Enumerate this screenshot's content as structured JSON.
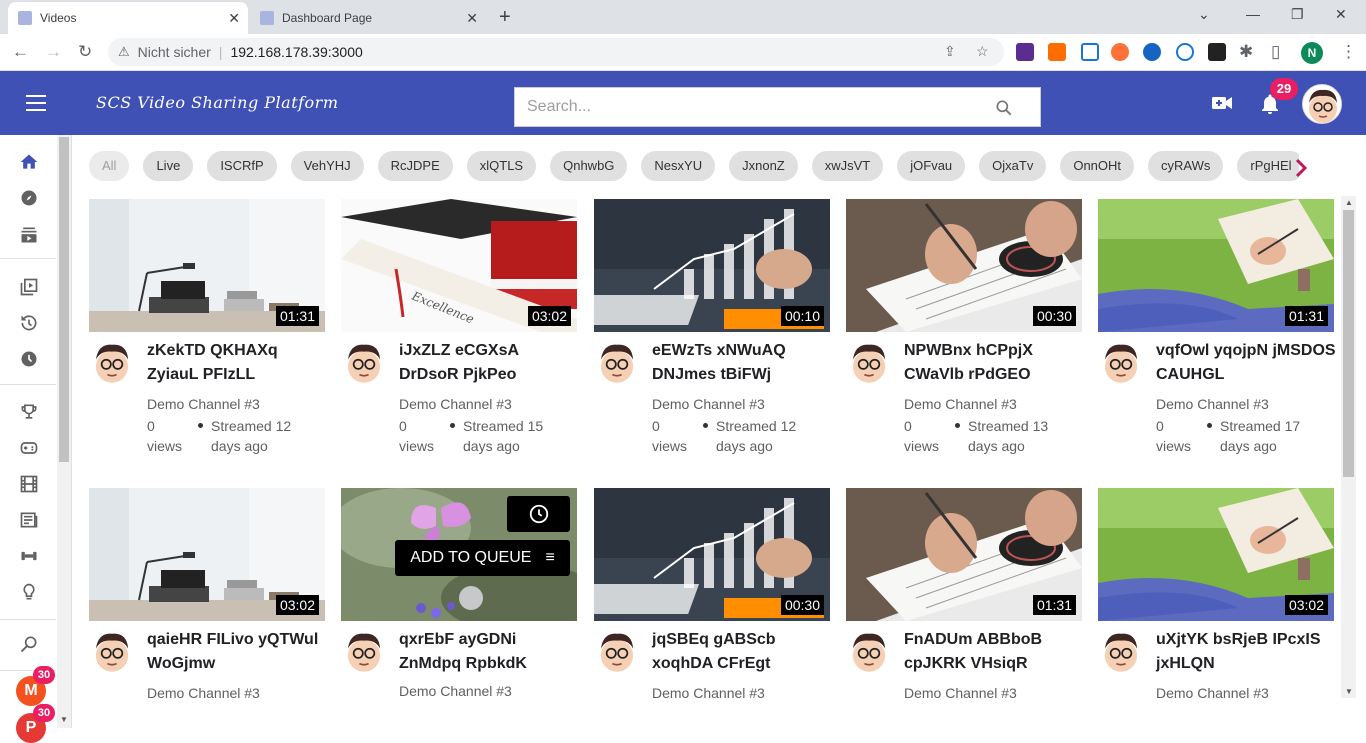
{
  "browser": {
    "tabs": [
      {
        "title": "Videos",
        "active": true
      },
      {
        "title": "Dashboard Page",
        "active": false
      }
    ],
    "security_label": "Nicht sicher",
    "url": "192.168.178.39:3000",
    "profile_initial": "N",
    "extensions": [
      "shield-10-extension",
      "off-extension",
      "camera-extension",
      "firefox-extension",
      "amazon-extension",
      "reader-extension",
      "angular-extension",
      "puzzle-extension",
      "sidebar-extension"
    ],
    "extension_badges": {
      "shield": "10",
      "off": "off"
    }
  },
  "header": {
    "logo_text": "SCS Video Sharing Platform",
    "search_placeholder": "Search...",
    "notification_count": "29",
    "brand_color": "#3f51b5"
  },
  "sidebar": {
    "items": [
      "home-icon",
      "explore-icon",
      "subscriptions-icon",
      "library-icon",
      "history-icon",
      "watch-later-icon",
      "trophy-icon",
      "gaming-icon",
      "movies-icon",
      "news-icon",
      "sports-icon",
      "learning-icon",
      "search-icon"
    ],
    "users": [
      {
        "initial": "M",
        "badge": "30",
        "color": "#f4511e"
      },
      {
        "initial": "P",
        "badge": "30",
        "color": "#e53935"
      }
    ]
  },
  "chips": [
    "All",
    "Live",
    "ISCRfP",
    "VehYHJ",
    "RcJDPE",
    "xlQTLS",
    "QnhwbG",
    "NesxYU",
    "JxnonZ",
    "xwJsVT",
    "jOFvau",
    "OjxaTv",
    "OnnOHt",
    "cyRAWs",
    "rPgHEl"
  ],
  "videos": [
    {
      "title": "zKekTD QKHAXq ZyiauL PFIzLL",
      "channel": "Demo Channel #3",
      "views": "0 views",
      "streamed": "Streamed 12 days ago",
      "duration": "01:31",
      "thumb": "desk"
    },
    {
      "title": "iJxZLZ eCGXsA DrDsoR PjkPeo",
      "channel": "Demo Channel #3",
      "views": "0 views",
      "streamed": "Streamed 15 days ago",
      "duration": "03:02",
      "thumb": "grad"
    },
    {
      "title": "eEWzTs xNWuAQ DNJmes tBiFWj",
      "channel": "Demo Channel #3",
      "views": "0 views",
      "streamed": "Streamed 12 days ago",
      "duration": "00:10",
      "thumb": "chart"
    },
    {
      "title": "NPWBnx hCPpjX CWaVlb rPdGEO",
      "channel": "Demo Channel #3",
      "views": "0 views",
      "streamed": "Streamed 13 days ago",
      "duration": "00:30",
      "thumb": "writing"
    },
    {
      "title": "vqfOwl yqojpN jMSDOS CAUHGL",
      "channel": "Demo Channel #3",
      "views": "0 views",
      "streamed": "Streamed 17 days ago",
      "duration": "01:31",
      "thumb": "grass"
    },
    {
      "title": "qaieHR FILivo yQTWul WoGjmw",
      "channel": "Demo Channel #3",
      "views": "",
      "streamed": "",
      "duration": "03:02",
      "thumb": "desk"
    },
    {
      "title": "qxrEbF ayGDNi ZnMdpq RpbkdK",
      "channel": "Demo Channel #3",
      "views": "",
      "streamed": "",
      "duration": "",
      "thumb": "butterfly",
      "add_to_queue": "ADD TO QUEUE"
    },
    {
      "title": "jqSBEq gABScb xoqhDA CFrEgt",
      "channel": "Demo Channel #3",
      "views": "",
      "streamed": "",
      "duration": "00:30",
      "thumb": "chart"
    },
    {
      "title": "FnADUm ABBboB cpJKRK VHsiqR",
      "channel": "Demo Channel #3",
      "views": "",
      "streamed": "",
      "duration": "01:31",
      "thumb": "writing"
    },
    {
      "title": "uXjtYK bsRjeB IPcxIS jxHLQN",
      "channel": "Demo Channel #3",
      "views": "",
      "streamed": "",
      "duration": "03:02",
      "thumb": "grass"
    }
  ]
}
